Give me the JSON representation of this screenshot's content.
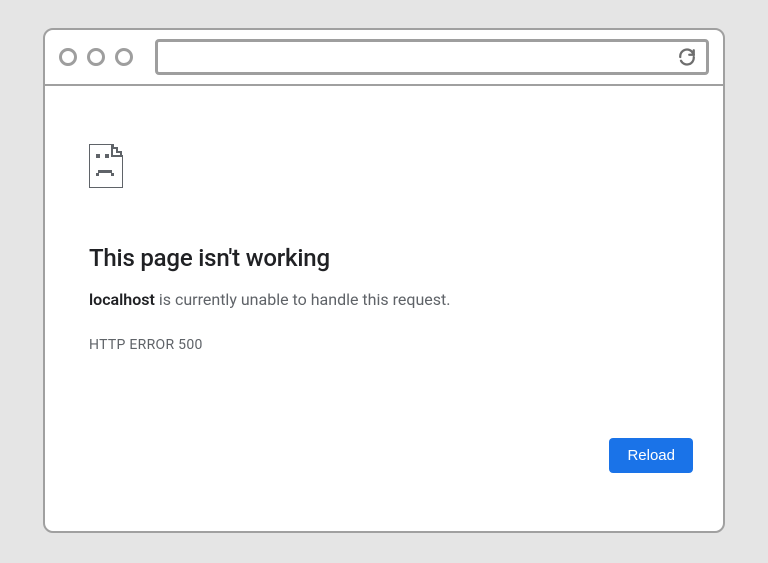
{
  "toolbar": {
    "address_value": ""
  },
  "error": {
    "icon": "sad-page-icon",
    "title": "This page isn't working",
    "host": "localhost",
    "message_suffix": " is currently unable to handle this request.",
    "code": "HTTP ERROR 500",
    "reload_label": "Reload"
  }
}
